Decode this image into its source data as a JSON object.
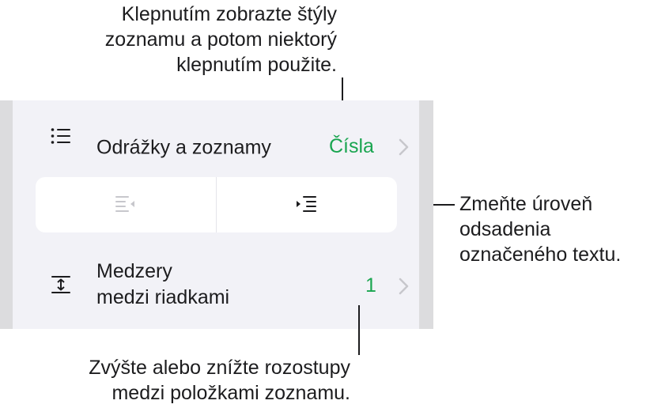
{
  "callouts": {
    "top": [
      "Klepnutím zobrazte štýly",
      "zoznamu a potom niektorý",
      "klepnutím použite."
    ],
    "right": [
      "Zmeňte úroveň",
      "odsadenia",
      "označeného textu."
    ],
    "bottom": [
      "Zvýšte alebo znížte rozostupy",
      "medzi položkami zoznamu."
    ]
  },
  "panel": {
    "lists_row": {
      "label": "Odrážky a zoznamy",
      "value": "Čísla",
      "icon": "list-bullets-icon"
    },
    "indent_control": {
      "decrease_icon": "decrease-indent-icon",
      "increase_icon": "increase-indent-icon",
      "decrease_enabled": false,
      "increase_enabled": true
    },
    "spacing_row": {
      "label_line1": "Medzery",
      "label_line2": "medzi riadkami",
      "value": "1",
      "icon": "line-spacing-icon"
    }
  },
  "colors": {
    "accent": "#1aa550",
    "panel_bg": "#f2f2f7",
    "panel_edge": "#dcdcde",
    "control_bg": "#ffffff",
    "chevron": "#c7c7cc",
    "disabled_icon": "#c7c7cc"
  }
}
